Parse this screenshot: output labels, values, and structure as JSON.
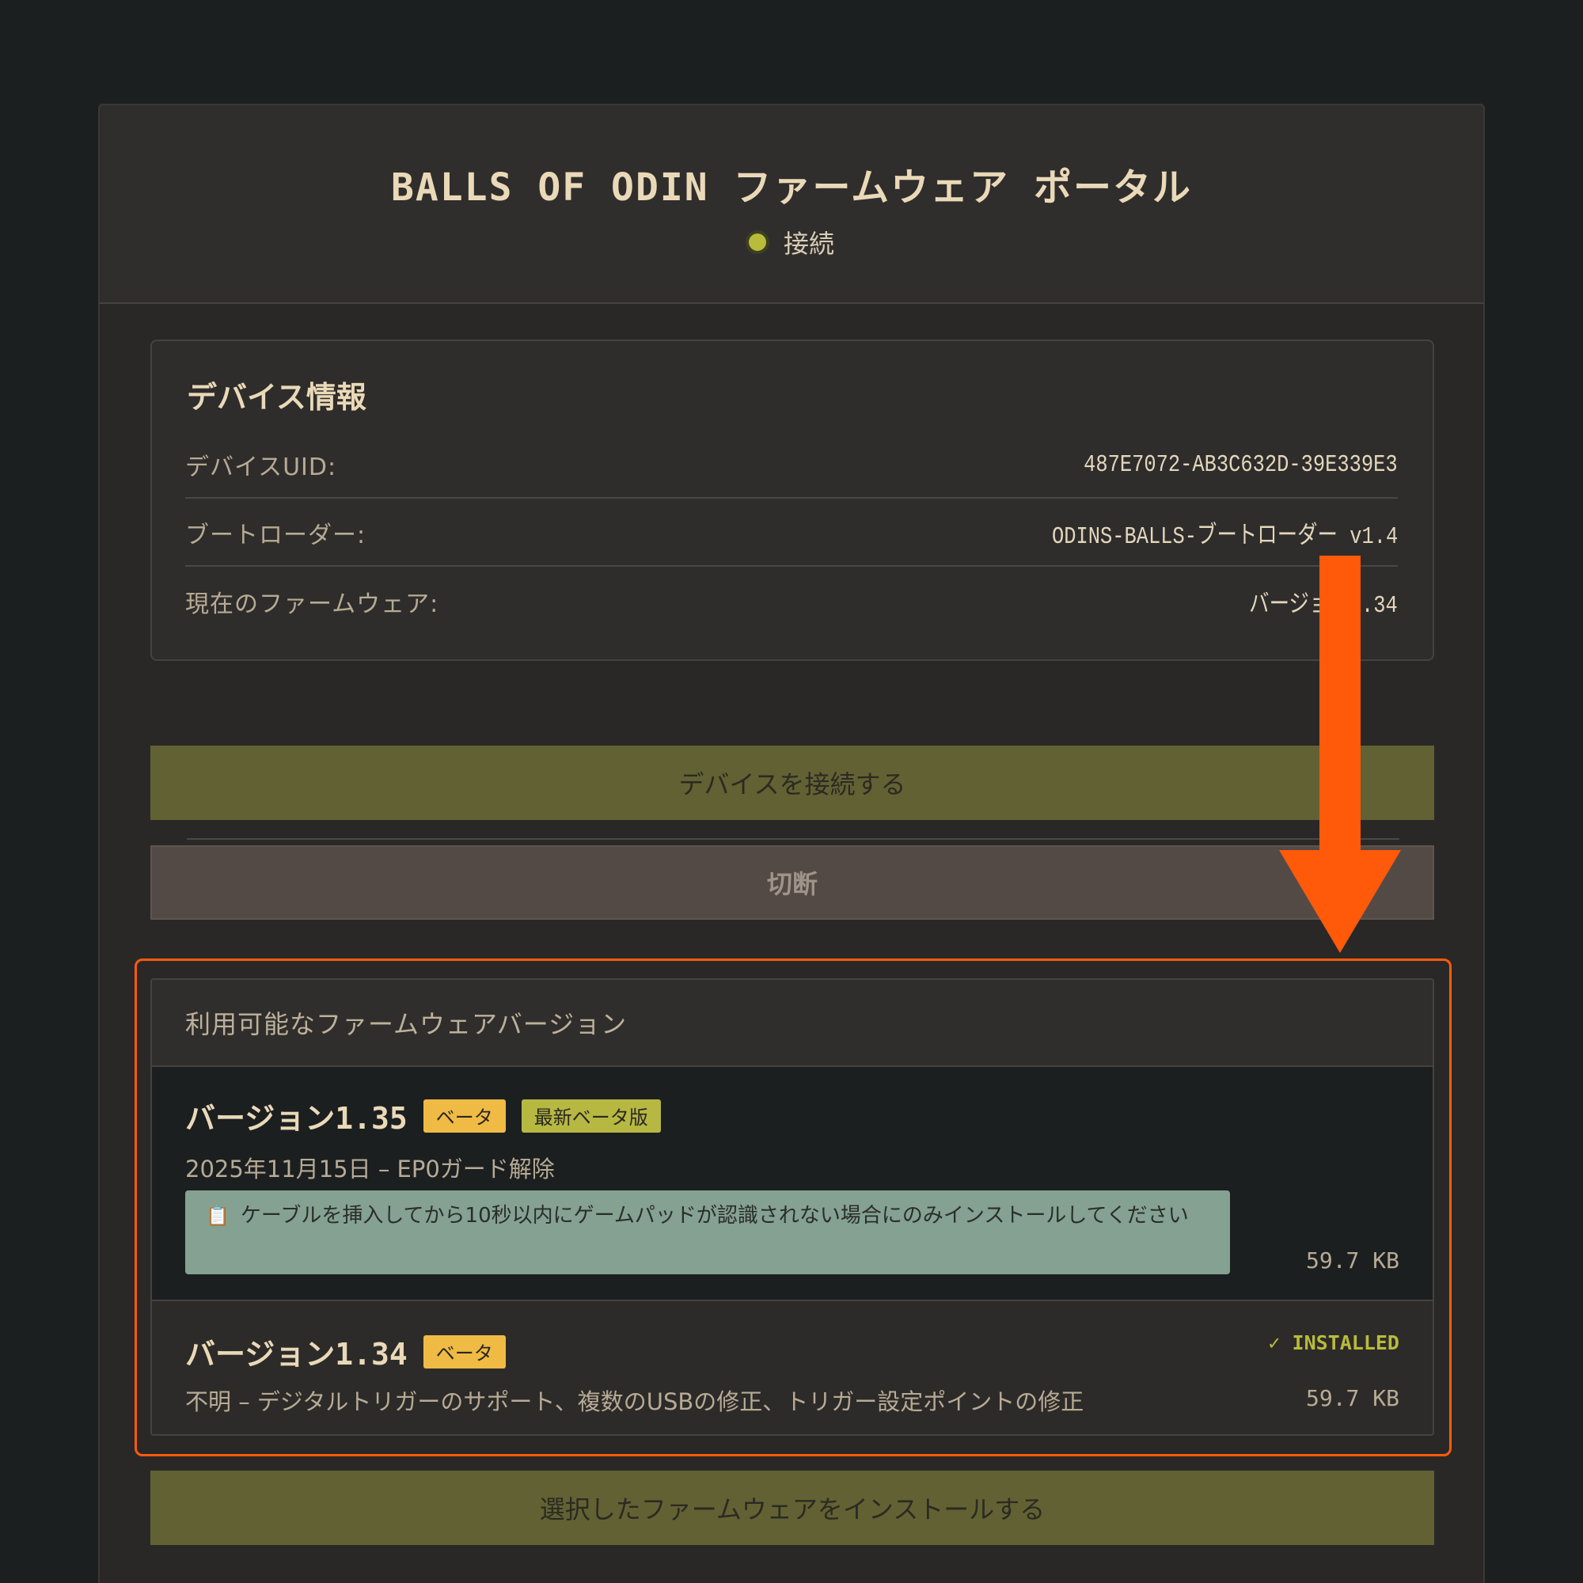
{
  "header": {
    "title": "BALLS OF ODIN ファームウェア ポータル",
    "status_text": "接続"
  },
  "device_info": {
    "title": "デバイス情報",
    "rows": [
      {
        "label": "デバイスUID:",
        "value": "487E7072-AB3C632D-39E339E3"
      },
      {
        "label": "ブートローダー:",
        "value": "ODINS-BALLS-ブートローダー v1.4"
      },
      {
        "label": "現在のファームウェア:",
        "value": "バージョン1.34"
      }
    ]
  },
  "buttons": {
    "connect": "デバイスを接続する",
    "disconnect": "切断",
    "install": "選択したファームウェアをインストールする"
  },
  "firmware": {
    "header": "利用可能なファームウェアバージョン",
    "versions": [
      {
        "name": "バージョン1.35",
        "badges": [
          "ベータ",
          "最新ベータ版"
        ],
        "description": "2025年11月15日 – EP0ガード解除",
        "note": "ケーブルを挿入してから10秒以内にゲームパッドが認識されない場合にのみインストールしてください",
        "size": "59.7 KB",
        "selected": true
      },
      {
        "name": "バージョン1.34",
        "badges": [
          "ベータ"
        ],
        "description": "不明 – デジタルトリガーのサポート、複数のUSBの修正、トリガー設定ポイントの修正",
        "size": "59.7 KB",
        "status": "✓ INSTALLED"
      }
    ]
  },
  "colors": {
    "accent": "#b9bb3a",
    "highlight": "#ff5a0a",
    "beta_badge": "#f0bb44",
    "latest_badge": "#b6b842",
    "note_bg": "#84a192"
  },
  "icons": {
    "status": "status-dot-icon",
    "note": "clipboard-icon",
    "annotation": "down-arrow-icon"
  }
}
